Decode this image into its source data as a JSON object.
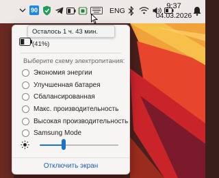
{
  "taskbar": {
    "badge_number": "90",
    "language": "ENG",
    "time": "9:37",
    "date": "04.03.2026",
    "icons": [
      "chevron-down-icon",
      "app-badge-icon",
      "shield-check-icon",
      "telegram-icon",
      "battery-icon",
      "chip-icon",
      "language-indicator",
      "bluetooth-icon",
      "wifi-icon",
      "volume-icon",
      "battery-status-icon",
      "notifications-icon"
    ]
  },
  "tooltip": {
    "text": "Осталось 1 ч. 43 мин. (41%)"
  },
  "battery": {
    "level": 0.41,
    "scheme_title": "Выберите схему электропитания:",
    "plans": [
      "Экономия энергии",
      "Улучшенная батарея",
      "Сбалансированная",
      "Макс. производительность",
      "Высокая производительность",
      "Samsung Mode"
    ],
    "brightness": 0.3,
    "turn_off_display": "Отключить экран"
  },
  "colors": {
    "accent": "#1a73c8",
    "link": "#1a5fb4",
    "flyout_bg": "#f7f5f4"
  }
}
